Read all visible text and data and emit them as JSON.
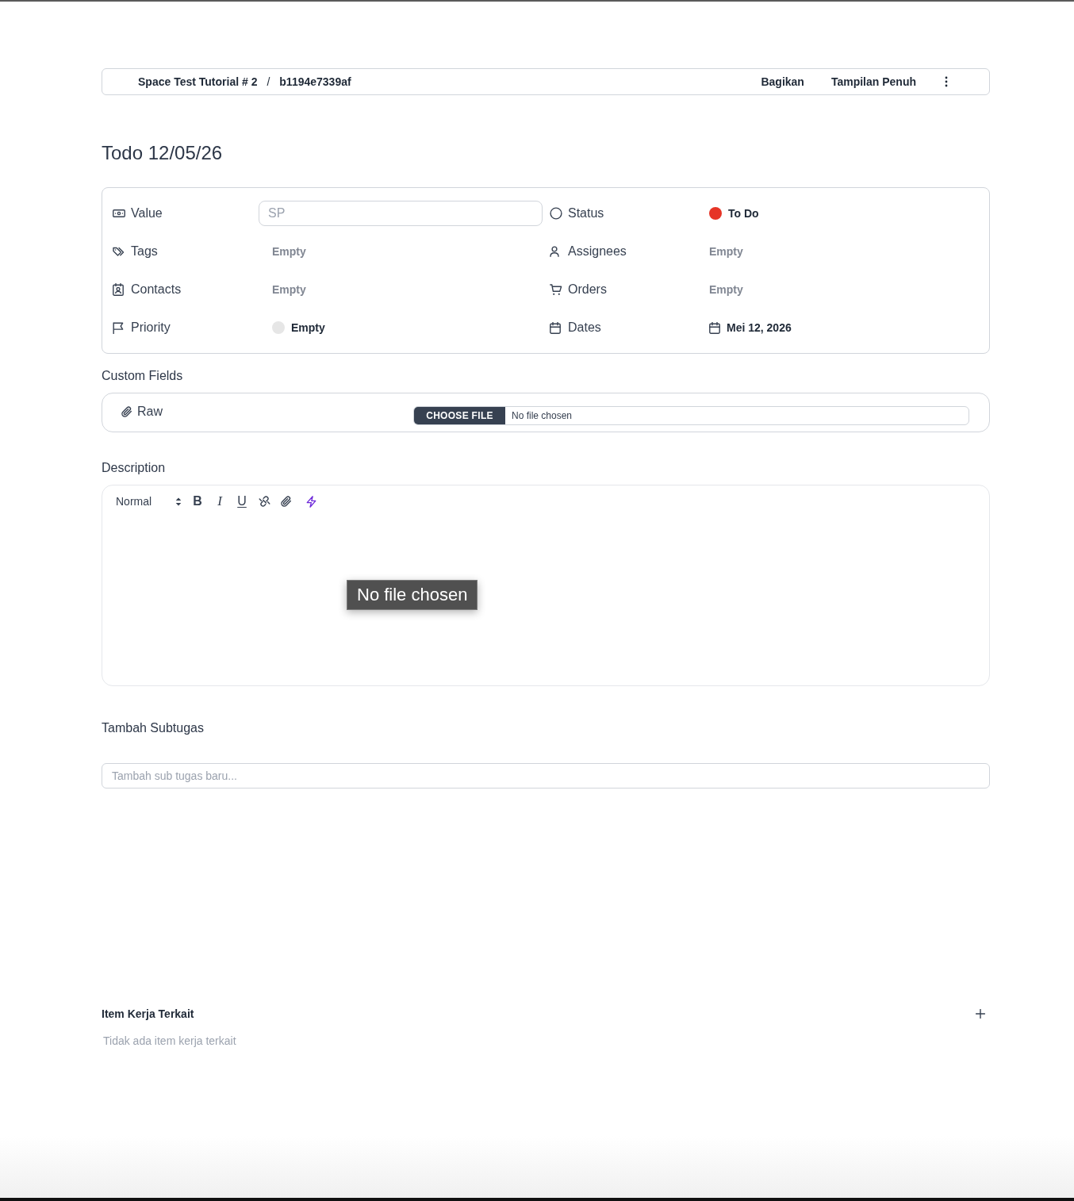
{
  "breadcrumb": {
    "items": [
      "Space Test Tutorial # 2",
      "b1194e7339af"
    ],
    "separator": "/"
  },
  "header_actions": [
    "Bagikan",
    "Tampilan Penuh"
  ],
  "title": "Todo 12/05/26",
  "properties": [
    {
      "label": "Value",
      "kind": "input",
      "placeholder": "SP"
    },
    {
      "label": "Status",
      "kind": "dot",
      "value": "To Do",
      "color": "#e63426"
    },
    {
      "label": "Tags",
      "kind": "empty",
      "value": "Empty"
    },
    {
      "label": "Assignees",
      "kind": "empty",
      "value": "Empty"
    },
    {
      "label": "Contacts",
      "kind": "empty",
      "value": "Empty"
    },
    {
      "label": "Orders",
      "kind": "empty",
      "value": "Empty"
    },
    {
      "label": "Priority",
      "kind": "dot",
      "value": "Empty",
      "color": "#e6e6e6"
    },
    {
      "label": "Dates",
      "kind": "date",
      "value": "Mei 12, 2026"
    }
  ],
  "custom_fields": {
    "title": "Custom Fields",
    "fields": [
      {
        "label": "Raw",
        "kind": "file",
        "button": "CHOOSE FILE",
        "value": "No file chosen"
      }
    ]
  },
  "description": {
    "title": "Description",
    "toolbar": {
      "format": "Normal",
      "buttons": [
        {
          "kind": "bold",
          "label": "B"
        },
        {
          "kind": "italic",
          "label": "I"
        },
        {
          "kind": "underline",
          "label": "U"
        },
        {
          "kind": "link"
        },
        {
          "kind": "attachment"
        },
        {
          "kind": "ai"
        }
      ]
    },
    "tooltip": "No file chosen"
  },
  "subtasks": {
    "title": "Tambah Subtugas",
    "placeholder": "Tambah sub tugas baru..."
  },
  "related": {
    "title": "Item Kerja Terkait",
    "empty": "Tidak ada item kerja terkait"
  }
}
